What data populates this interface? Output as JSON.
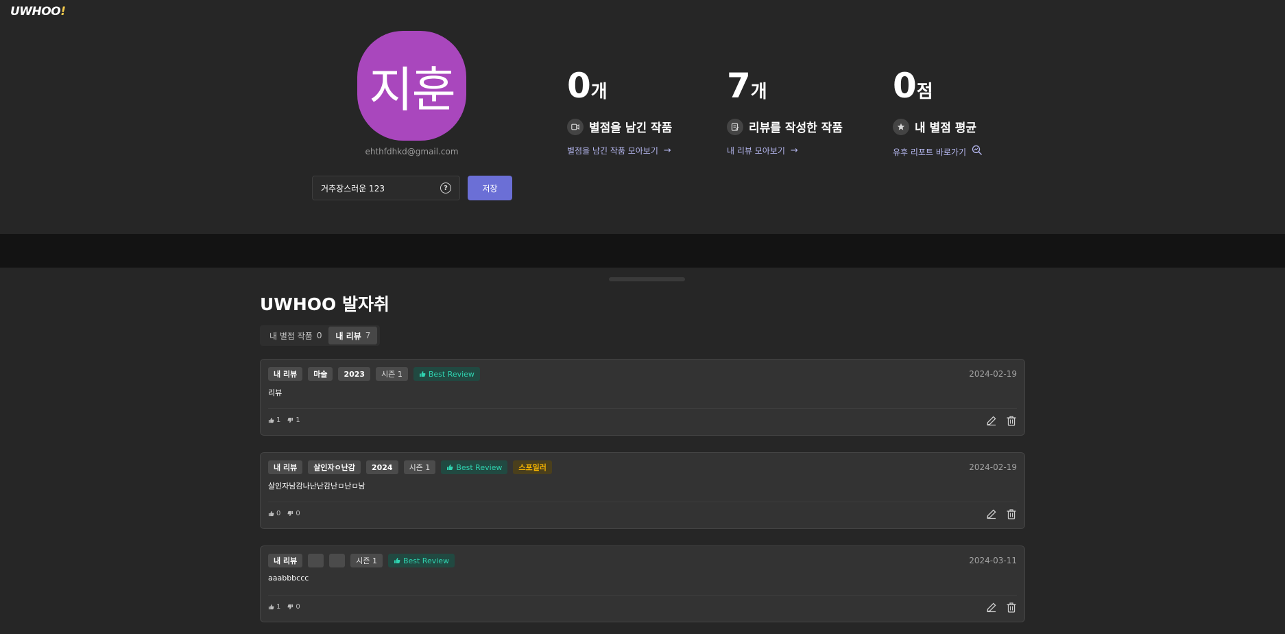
{
  "logo": {
    "text": "UWHOO",
    "bang": "!"
  },
  "profile": {
    "avatar_text": "지훈",
    "avatar_color": "#a947bd",
    "email": "ehthfdhkd@gmail.com",
    "nickname_value": "거추장스러운 123",
    "save_label": "저장"
  },
  "stats": [
    {
      "value": "0",
      "unit": "개",
      "label": "별점을 남긴 작품",
      "link": "별점을 남긴 작품 모아보기",
      "icon": "video-icon"
    },
    {
      "value": "7",
      "unit": "개",
      "label": "리뷰를 작성한 작품",
      "link": "내 리뷰 모아보기",
      "icon": "review-icon"
    },
    {
      "value": "0",
      "unit": "점",
      "label": "내 별점 평균",
      "link": "유후 리포트 바로가기",
      "icon": "star-icon"
    }
  ],
  "section_title": "UWHOO 발자취",
  "tabs": [
    {
      "label": "내 별점 작품",
      "count": "0"
    },
    {
      "label": "내 리뷰",
      "count": "7"
    }
  ],
  "reviews": [
    {
      "tags": [
        "내 리뷰",
        "마술",
        "2023",
        "시즌 1"
      ],
      "best": "Best Review",
      "spoiler": "",
      "date": "2024-02-19",
      "body": "리뷰",
      "likes": "1",
      "dislikes": "1"
    },
    {
      "tags": [
        "내 리뷰",
        "살인자ㅇ난감",
        "2024",
        "시즌 1"
      ],
      "best": "Best Review",
      "spoiler": "스포일러",
      "date": "2024-02-19",
      "body": "살인자남감나난난감난ㅁ난ㅁ남",
      "likes": "0",
      "dislikes": "0"
    },
    {
      "tags": [
        "내 리뷰",
        "",
        "",
        "시즌 1"
      ],
      "best": "Best Review",
      "spoiler": "",
      "date": "2024-03-11",
      "body": "aaabbbccc",
      "likes": "1",
      "dislikes": "0"
    }
  ],
  "colors": {
    "accent": "#6b6fd6",
    "link": "#b4b6ee",
    "best": "#2fd3b0",
    "spoiler": "#f7b500"
  }
}
